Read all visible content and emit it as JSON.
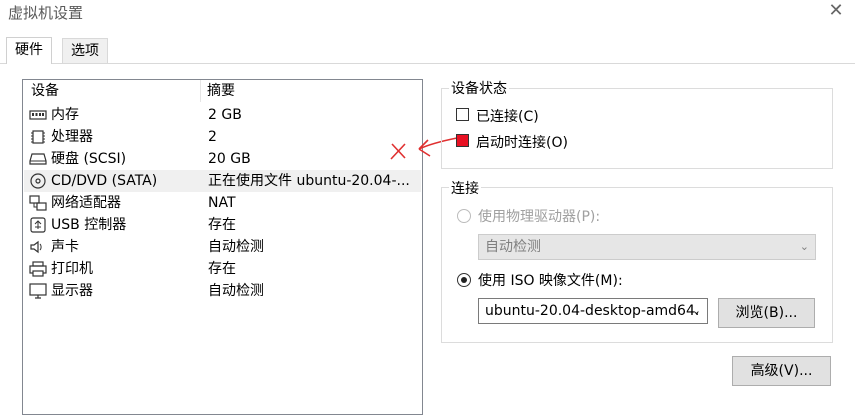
{
  "window": {
    "title": "虚拟机设置",
    "close": "✕"
  },
  "tabs": [
    {
      "label": "硬件"
    },
    {
      "label": "选项"
    }
  ],
  "device_list": {
    "headers": {
      "device": "设备",
      "summary": "摘要"
    },
    "rows": [
      {
        "name": "内存",
        "summary": "2 GB",
        "icon": "memory-icon"
      },
      {
        "name": "处理器",
        "summary": "2",
        "icon": "processor-icon"
      },
      {
        "name": "硬盘 (SCSI)",
        "summary": "20 GB",
        "icon": "hard-disk-icon"
      },
      {
        "name": "CD/DVD (SATA)",
        "summary": "正在使用文件 ubuntu-20.04-...",
        "icon": "cd-dvd-icon"
      },
      {
        "name": "网络适配器",
        "summary": "NAT",
        "icon": "network-adapter-icon"
      },
      {
        "name": "USB 控制器",
        "summary": "存在",
        "icon": "usb-icon"
      },
      {
        "name": "声卡",
        "summary": "自动检测",
        "icon": "speaker-icon"
      },
      {
        "name": "打印机",
        "summary": "存在",
        "icon": "printer-icon"
      },
      {
        "name": "显示器",
        "summary": "自动检测",
        "icon": "monitor-icon"
      }
    ]
  },
  "device_status": {
    "title": "设备状态",
    "connected_label": "已连接(C)",
    "connect_at_power_on_label": "启动时连接(O)"
  },
  "connection": {
    "title": "连接",
    "physical_drive_label": "使用物理驱动器(P):",
    "physical_drive_value": "自动检测",
    "iso_label": "使用 ISO 映像文件(M):",
    "iso_value": "ubuntu-20.04-desktop-amd64.",
    "browse_label": "浏览(B)..."
  },
  "advanced_label": "高级(V)...",
  "colors": {
    "annotation_red": "#e81123",
    "selected_row": "#f0f0f0"
  }
}
